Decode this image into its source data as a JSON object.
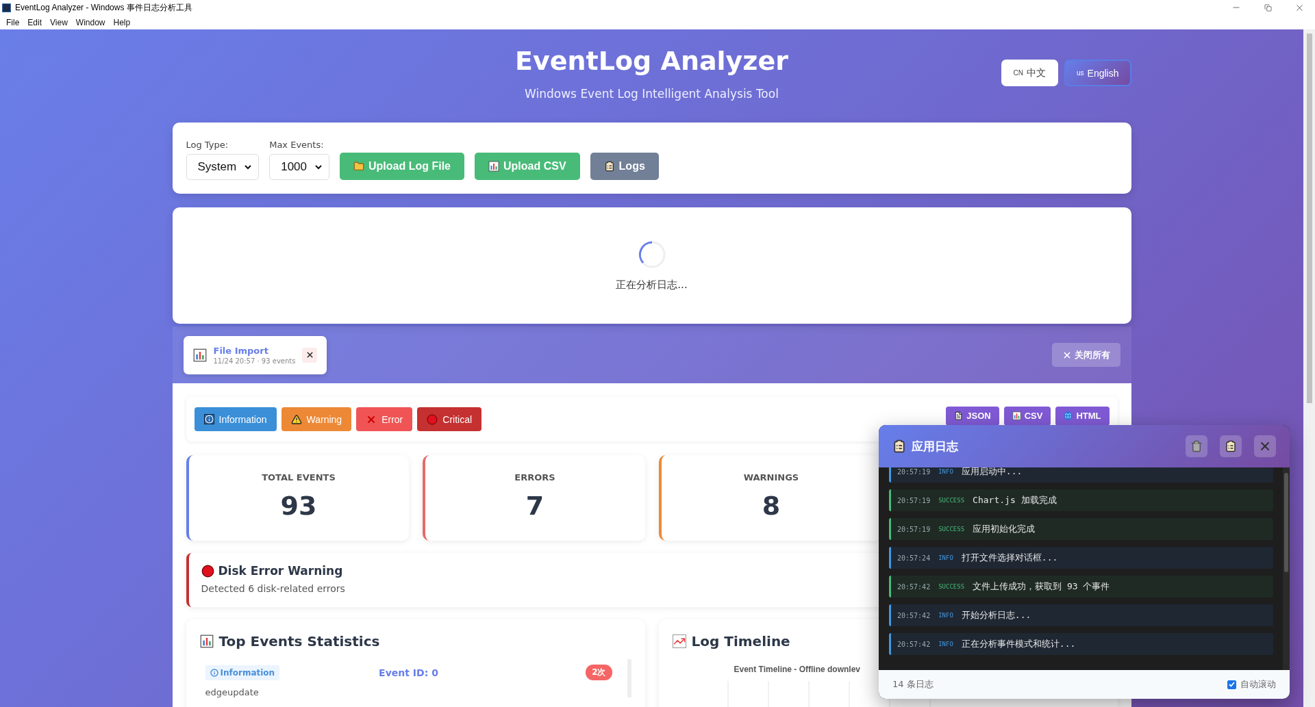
{
  "window": {
    "title": "EventLog Analyzer - Windows 事件日志分析工具"
  },
  "menu": [
    "File",
    "Edit",
    "View",
    "Window",
    "Help"
  ],
  "header": {
    "title": "EventLog Analyzer",
    "subtitle": "Windows Event Log Intelligent Analysis Tool"
  },
  "languages": [
    {
      "code": "CN",
      "label": "中文",
      "selected": false
    },
    {
      "code": "us",
      "label": "English",
      "selected": true
    }
  ],
  "toolbar": {
    "fields": [
      {
        "label": "Log Type:",
        "value": "System"
      },
      {
        "label": "Max Events:",
        "value": "1000"
      }
    ],
    "buttons": [
      {
        "label": "Upload Log File",
        "kind": "folder"
      },
      {
        "label": "Upload CSV",
        "kind": "chart"
      },
      {
        "label": "Logs",
        "kind": "logs"
      }
    ]
  },
  "loading": {
    "text": "正在分析日志..."
  },
  "file_tabs": {
    "tabs": [
      {
        "title": "File Import",
        "meta": "11/24 20:57 · 93 events",
        "selected": true
      }
    ],
    "close_all": "关闭所有"
  },
  "filters": [
    {
      "label": "Information",
      "kind": "info"
    },
    {
      "label": "Warning",
      "kind": "warning"
    },
    {
      "label": "Error",
      "kind": "error"
    },
    {
      "label": "Critical",
      "kind": "critical"
    }
  ],
  "exports": [
    {
      "label": "JSON",
      "kind": "json"
    },
    {
      "label": "CSV",
      "kind": "csv"
    },
    {
      "label": "HTML",
      "kind": "html"
    }
  ],
  "stats": [
    {
      "label": "TOTAL EVENTS",
      "value": "93",
      "kind": "total"
    },
    {
      "label": "ERRORS",
      "value": "7",
      "kind": "error"
    },
    {
      "label": "WARNINGS",
      "value": "8",
      "kind": "warning"
    }
  ],
  "alert": {
    "title": "Disk Error Warning",
    "text": "Detected 6 disk-related errors"
  },
  "top_events": {
    "title": "Top Events Statistics",
    "items": [
      {
        "level": "Information",
        "event_id": "Event ID: 0",
        "count": "2次",
        "source": "edgeupdate"
      }
    ]
  },
  "timeline": {
    "title": "Log Timeline",
    "chart_title": "Event Timeline - Offline downlev"
  },
  "log_panel": {
    "title": "应用日志",
    "entries": [
      {
        "time": "20:57:19",
        "level": "INFO",
        "kind": "info",
        "message": "应用启动中..."
      },
      {
        "time": "20:57:19",
        "level": "SUCCESS",
        "kind": "success",
        "message": "Chart.js 加载完成"
      },
      {
        "time": "20:57:19",
        "level": "SUCCESS",
        "kind": "success",
        "message": "应用初始化完成"
      },
      {
        "time": "20:57:24",
        "level": "INFO",
        "kind": "info",
        "message": "打开文件选择对话框..."
      },
      {
        "time": "20:57:42",
        "level": "SUCCESS",
        "kind": "success",
        "message": "文件上传成功，获取到 93 个事件"
      },
      {
        "time": "20:57:42",
        "level": "INFO",
        "kind": "info",
        "message": "开始分析日志..."
      },
      {
        "time": "20:57:42",
        "level": "INFO",
        "kind": "info",
        "message": "正在分析事件模式和统计..."
      }
    ],
    "count": "14 条日志",
    "auto_scroll": {
      "label": "自动滚动",
      "checked": true
    }
  }
}
